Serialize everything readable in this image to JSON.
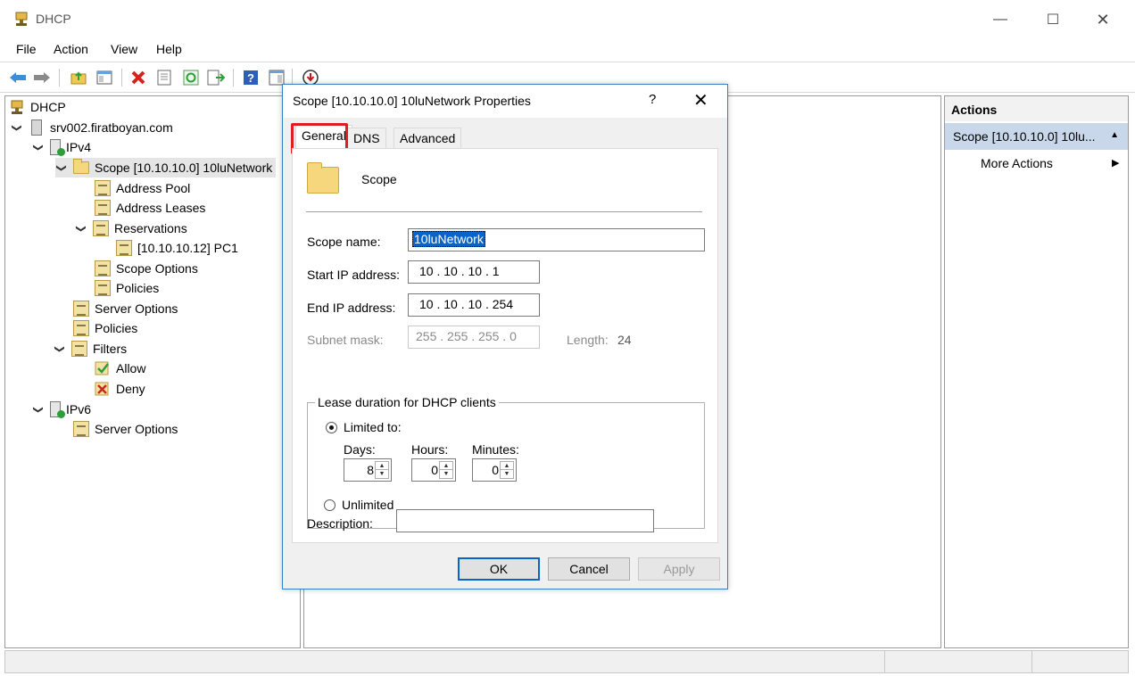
{
  "window": {
    "title": "DHCP",
    "minimize": "—",
    "maximize": "☐",
    "close": "✕"
  },
  "menu": {
    "file": "File",
    "action": "Action",
    "view": "View",
    "help": "Help"
  },
  "toolbar": {
    "icons": [
      "back-arrow-icon",
      "forward-arrow-icon",
      "up-folder-icon",
      "show-hide-tree-icon",
      "delete-icon",
      "properties-icon",
      "refresh-icon",
      "export-list-icon",
      "help-icon",
      "show-hide-action-pane-icon",
      "download-icon"
    ]
  },
  "tree": {
    "root": "DHCP",
    "server": "srv002.firatboyan.com",
    "ipv4": "IPv4",
    "scope": "Scope [10.10.10.0] 10luNetwork",
    "address_pool": "Address Pool",
    "address_leases": "Address Leases",
    "reservations": "Reservations",
    "reservation_item": "[10.10.10.12] PC1",
    "scope_options": "Scope Options",
    "scope_policies": "Policies",
    "server_options": "Server Options",
    "policies": "Policies",
    "filters": "Filters",
    "allow": "Allow",
    "deny": "Deny",
    "ipv6": "IPv6",
    "ipv6_server_options": "Server Options"
  },
  "actions": {
    "header": "Actions",
    "scope": "Scope [10.10.10.0] 10lu...",
    "more": "More Actions"
  },
  "dialog": {
    "title": "Scope [10.10.10.0] 10luNetwork Properties",
    "help": "?",
    "close": "✕",
    "tabs": {
      "general": "General",
      "dns": "DNS",
      "advanced": "Advanced"
    },
    "scope_heading": "Scope",
    "scope_name_label": "Scope name:",
    "scope_name_value": "10luNetwork",
    "start_ip_label": "Start IP address:",
    "start_ip_value": "10 . 10 . 10 . 1",
    "end_ip_label": "End IP address:",
    "end_ip_value": "10 . 10 . 10 . 254",
    "subnet_label": "Subnet mask:",
    "subnet_value": "255 . 255 . 255 . 0",
    "length_label": "Length:",
    "length_value": "24",
    "lease_group": "Lease duration for DHCP clients",
    "limited_label": "Limited to:",
    "days_label": "Days:",
    "days_value": "8",
    "hours_label": "Hours:",
    "hours_value": "0",
    "minutes_label": "Minutes:",
    "minutes_value": "0",
    "unlimited_label": "Unlimited",
    "description_label": "Description:",
    "description_value": "",
    "ok": "OK",
    "cancel": "Cancel",
    "apply": "Apply"
  },
  "colors": {
    "highlight_tab_border": "#e31b23",
    "selection_blue": "#0a64c8",
    "actions_selected": "#c8d8ea"
  }
}
